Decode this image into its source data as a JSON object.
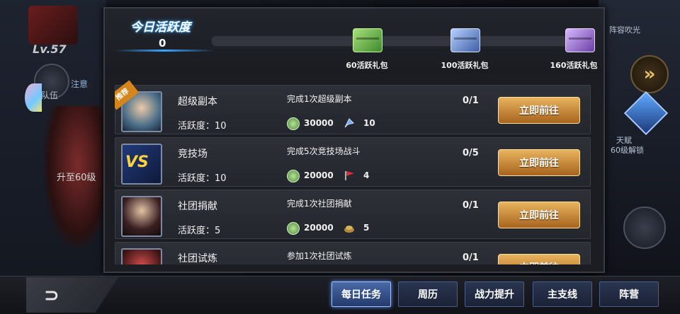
{
  "player": {
    "level": "Lv.57",
    "upgrade_text": "升至60级",
    "team_label": "队伍",
    "team_sub": "注意"
  },
  "right_panel": {
    "top_text": "阵容吹光",
    "unlock_title": "天赋",
    "unlock_sub": "60级解锁"
  },
  "activity": {
    "title": "今日活跃度",
    "value": "0",
    "rewards": [
      {
        "label": "60活跃礼包",
        "icon": "green-chest-icon"
      },
      {
        "label": "100活跃礼包",
        "icon": "blue-chest-icon"
      },
      {
        "label": "160活跃礼包",
        "icon": "purple-chest-icon"
      }
    ]
  },
  "tasks": [
    {
      "name": "超级副本",
      "points": "活跃度：10",
      "desc": "完成1次超级副本",
      "coin": "30000",
      "item_value": "10",
      "progress": "0/1",
      "button": "立即前往",
      "badge": "推荐",
      "icon": "fighter-portrait-icon",
      "item_icon": "blue-crystal-icon"
    },
    {
      "name": "竞技场",
      "points": "活跃度：10",
      "desc": "完成5次竞技场战斗",
      "coin": "20000",
      "item_value": "4",
      "progress": "0/5",
      "button": "立即前往",
      "icon": "vs-icon",
      "item_icon": "red-flag-icon",
      "icon_text": "VS"
    },
    {
      "name": "社团捐献",
      "points": "活跃度：5",
      "desc": "完成1次社团捐献",
      "coin": "20000",
      "item_value": "5",
      "progress": "0/1",
      "button": "立即前往",
      "icon": "fighter-portrait-icon",
      "item_icon": "gold-pile-icon"
    },
    {
      "name": "社团试炼",
      "points": "",
      "desc": "参加1次社团试炼",
      "coin": "",
      "item_value": "",
      "progress": "0/1",
      "button": "立即前往",
      "icon": "red-fighter-icon",
      "item_icon": ""
    }
  ],
  "bottom_tabs": [
    {
      "label": "每日任务",
      "active": true
    },
    {
      "label": "周历",
      "active": false
    },
    {
      "label": "战力提升",
      "active": false
    },
    {
      "label": "主支线",
      "active": false
    },
    {
      "label": "阵营",
      "active": false
    }
  ],
  "colors": {
    "accent_gold": "#e8b35e",
    "active_tab": "#4a6aa8",
    "glow_blue": "#3aa6ff"
  }
}
